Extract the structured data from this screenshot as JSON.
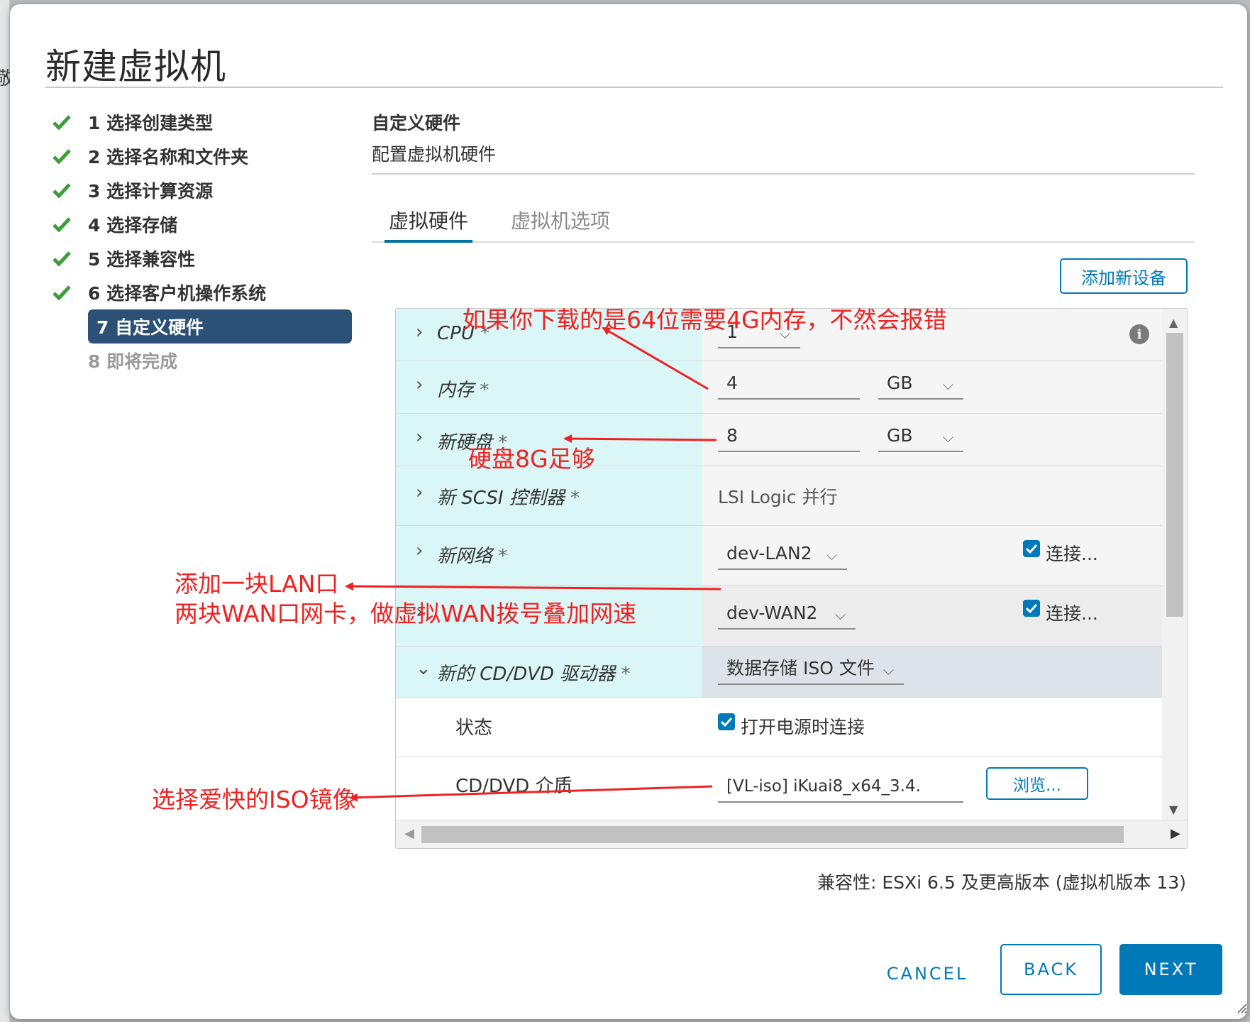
{
  "dialog": {
    "title": "新建虚拟机"
  },
  "steps": [
    {
      "label": "1 选择创建类型",
      "state": "done"
    },
    {
      "label": "2 选择名称和文件夹",
      "state": "done"
    },
    {
      "label": "3 选择计算资源",
      "state": "done"
    },
    {
      "label": "4 选择存储",
      "state": "done"
    },
    {
      "label": "5 选择兼容性",
      "state": "done"
    },
    {
      "label": "6 选择客户机操作系统",
      "state": "done"
    },
    {
      "label": "7 自定义硬件",
      "state": "active"
    },
    {
      "label": "8 即将完成",
      "state": "disabled"
    }
  ],
  "section": {
    "title": "自定义硬件",
    "subtitle": "配置虚拟机硬件"
  },
  "tabs": {
    "hardware": "虚拟硬件",
    "options": "虚拟机选项",
    "active": "虚拟硬件"
  },
  "add_device_label": "添加新设备",
  "hardware": {
    "cpu": {
      "label": "CPU",
      "req": "*",
      "value": "1"
    },
    "memory": {
      "label": "内存",
      "req": "*",
      "value": "4",
      "unit": "GB"
    },
    "disk": {
      "label": "新硬盘",
      "req": "*",
      "value": "8",
      "unit": "GB"
    },
    "scsi": {
      "label": "新 SCSI 控制器",
      "req": "*",
      "value": "LSI Logic 并行"
    },
    "net1": {
      "label": "新网络",
      "req": "*",
      "value": "dev-LAN2",
      "connect": "连接..."
    },
    "net2": {
      "value": "dev-WAN2",
      "connect": "连接..."
    },
    "cd": {
      "label": "新的 CD/DVD 驱动器",
      "req": "*",
      "value": "数据存储 ISO 文件"
    },
    "cd_status": {
      "label": "状态",
      "value": "打开电源时连接"
    },
    "cd_media": {
      "label": "CD/DVD 介质",
      "value": "[VL-iso] iKuai8_x64_3.4.",
      "browse": "浏览..."
    }
  },
  "compatibility": "兼容性: ESXi 6.5 及更高版本 (虚拟机版本 13)",
  "buttons": {
    "cancel": "CANCEL",
    "back": "BACK",
    "next": "NEXT"
  },
  "annotations": {
    "cpu_mem": "如果你下载的是64位需要4G内存，不然会报错",
    "disk": "硬盘8G足够",
    "net_line1": "添加一块LAN口",
    "net_line2": "两块WAN口网卡，做虚拟WAN拨号叠加网速",
    "iso": "选择爱快的ISO镜像"
  },
  "colors": {
    "accent": "#0079b8",
    "active_step": "#2d5176",
    "annotation": "#ee2222",
    "label_cell": "#daf6f6"
  }
}
